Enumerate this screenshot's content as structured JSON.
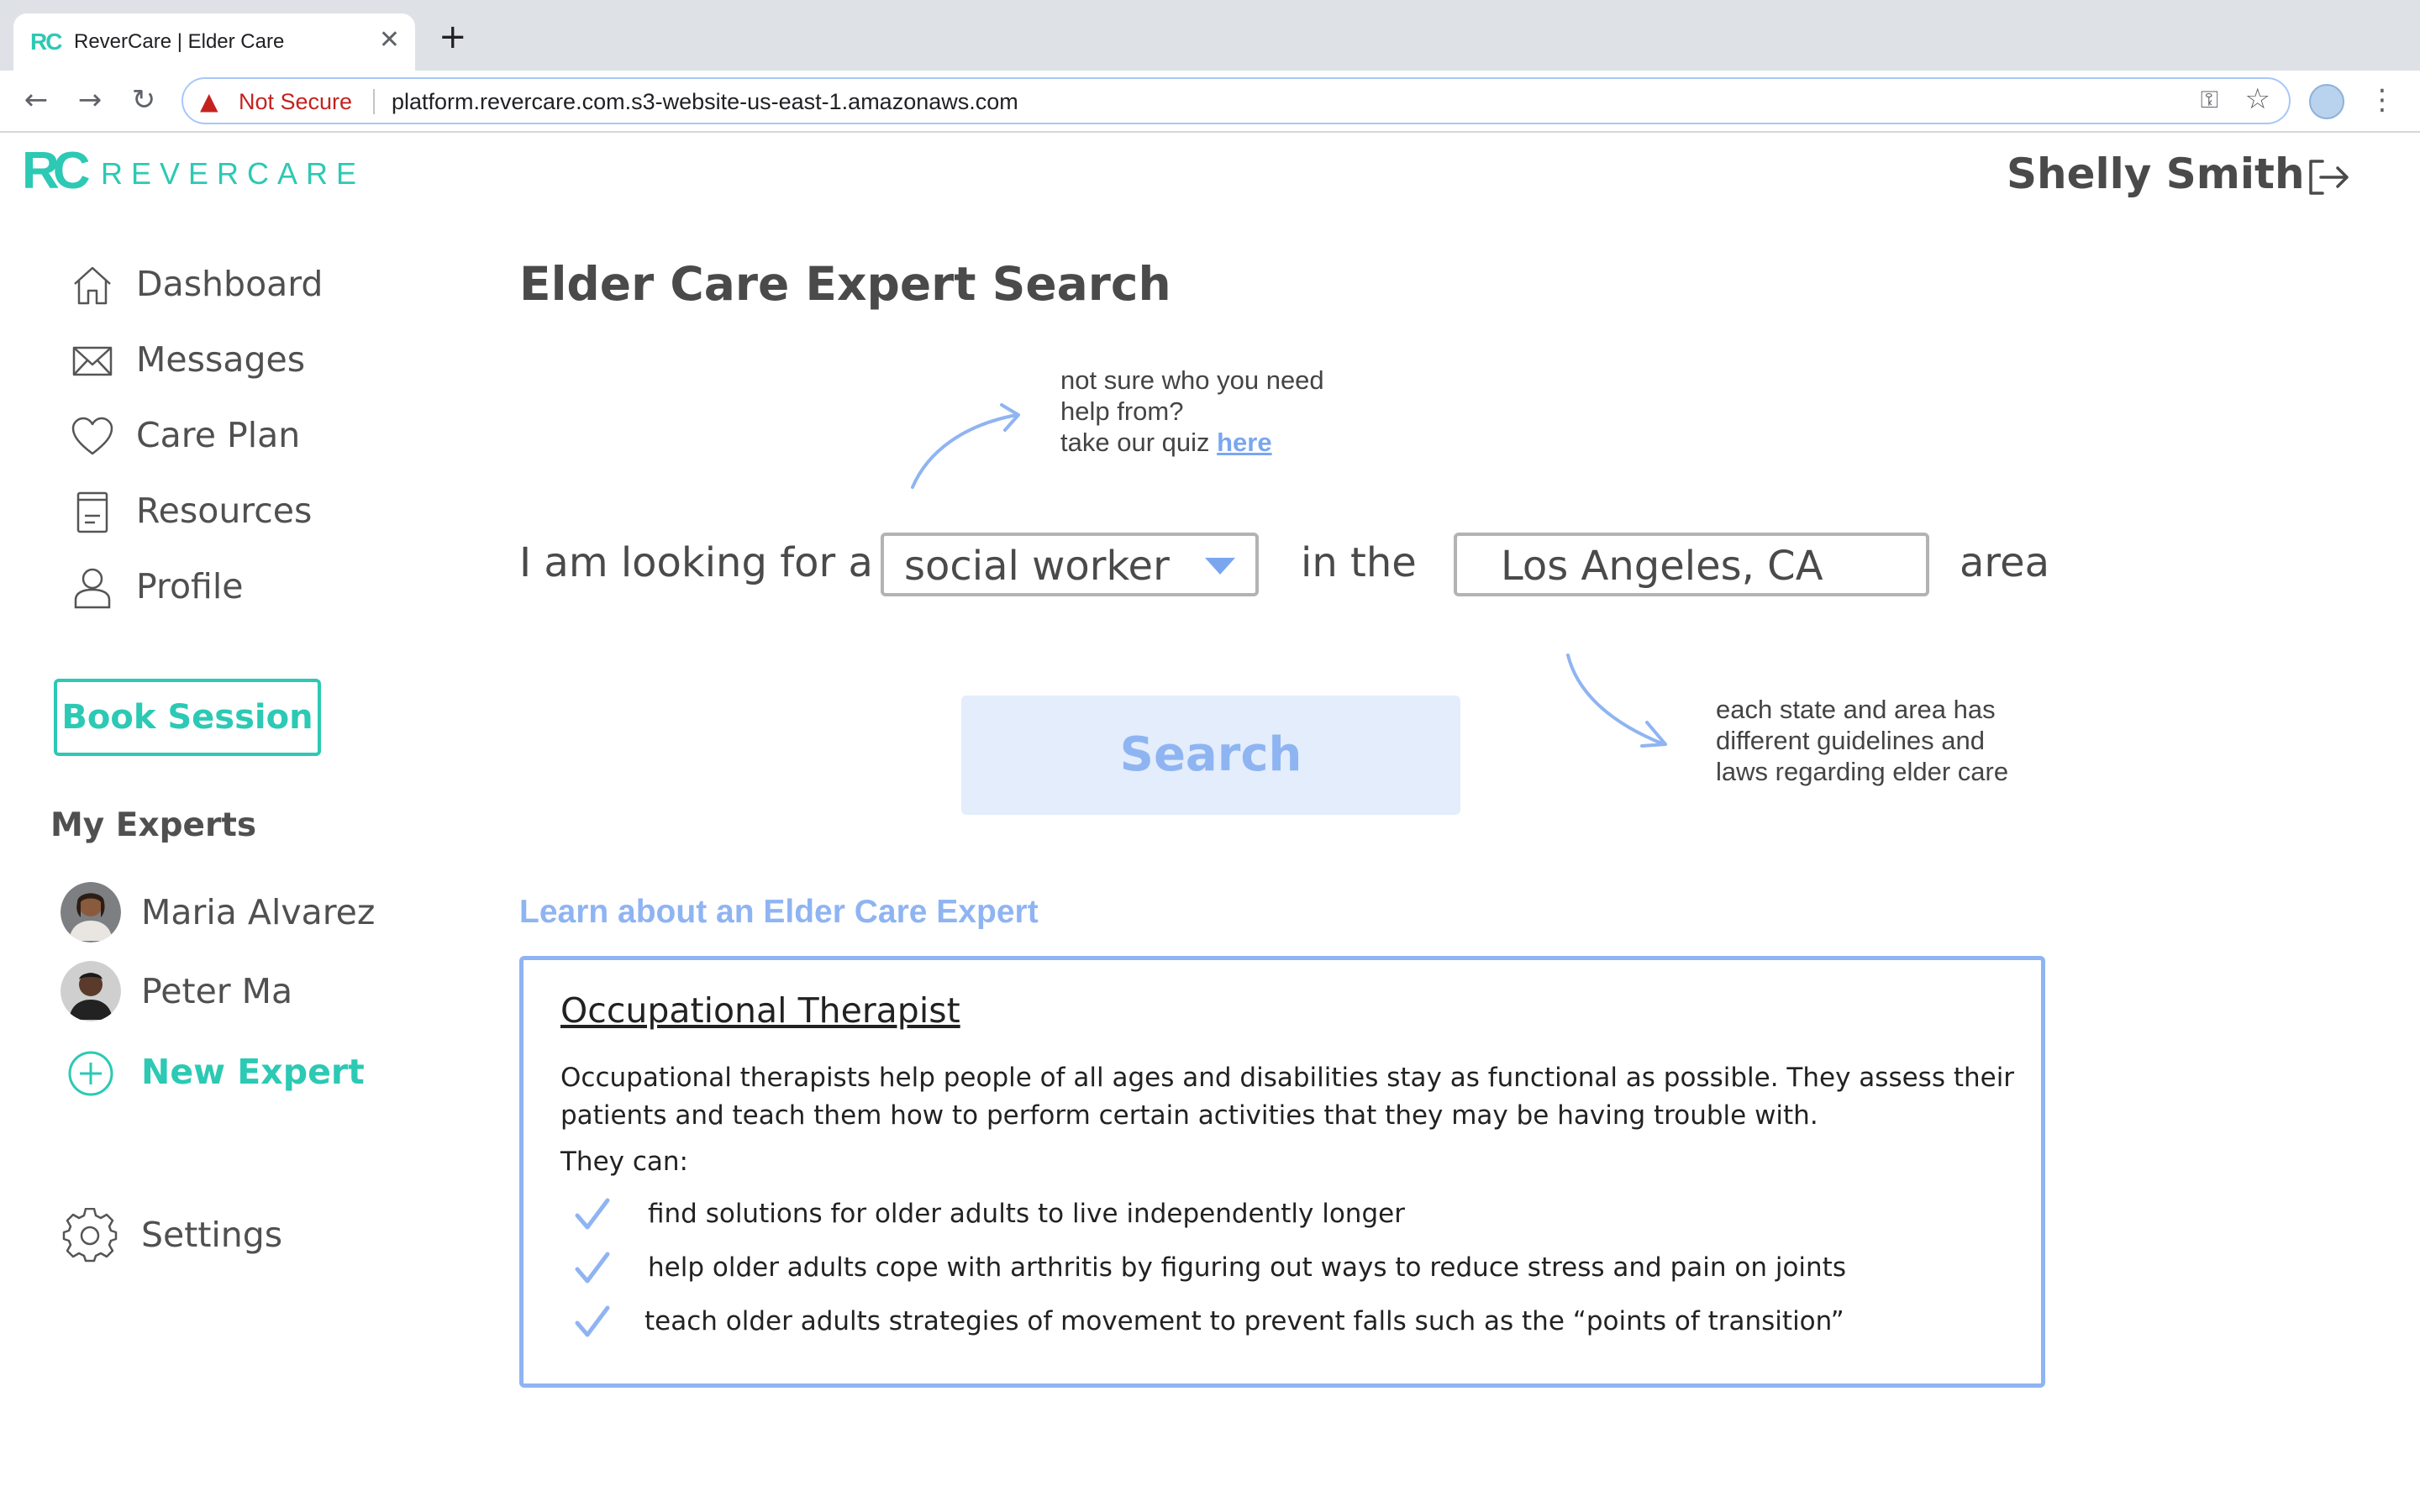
{
  "browser": {
    "tab_title": "ReverCare | Elder Care",
    "favicon_text": "RC",
    "security_label": "Not Secure",
    "url": "platform.revercare.com.s3-website-us-east-1.amazonaws.com"
  },
  "app": {
    "logo_mark": "RC",
    "logo_word": "REVERCARE",
    "brand_color": "#2cc9b4",
    "accent_color": "#8fb4f2",
    "user_name": "Shelly Smith"
  },
  "sidebar": {
    "items": [
      {
        "label": "Dashboard",
        "icon": "home-icon"
      },
      {
        "label": "Messages",
        "icon": "mail-icon"
      },
      {
        "label": "Care Plan",
        "icon": "heart-icon"
      },
      {
        "label": "Resources",
        "icon": "document-icon"
      },
      {
        "label": "Profile",
        "icon": "user-icon"
      }
    ],
    "book_session": "Book Session",
    "my_experts_heading": "My Experts",
    "experts": [
      {
        "name": "Maria Alvarez"
      },
      {
        "name": "Peter Ma"
      }
    ],
    "new_expert": "New Expert",
    "settings": "Settings"
  },
  "main": {
    "title": "Elder Care Expert Search",
    "quiz_hint": {
      "line1": "not sure who you need",
      "line2": "help from?",
      "line3": "take our quiz ",
      "link": "here"
    },
    "search_sentence": {
      "prefix": "I am looking for a",
      "expert_type": "social worker",
      "middle": "in the",
      "location": "Los Angeles, CA",
      "suffix": "area"
    },
    "state_hint": {
      "line1": "each state and area has",
      "line2": "different guidelines and",
      "line3": "laws regarding elder care"
    },
    "search_button": "Search",
    "learn_heading": "Learn about an Elder Care Expert",
    "card": {
      "title": "Occupational Therapist",
      "description": "Occupational therapists help people of all ages and disabilities stay as functional as possible. They assess their patients and teach them how to perform certain activities that they may be having trouble with.",
      "they_can": "They can:",
      "items": [
        "find solutions for older adults to live independently longer",
        "help older adults cope with arthritis by figuring out ways to reduce stress and pain on joints",
        "teach older adults strategies of movement to prevent falls such as the “points of transition”"
      ]
    }
  }
}
